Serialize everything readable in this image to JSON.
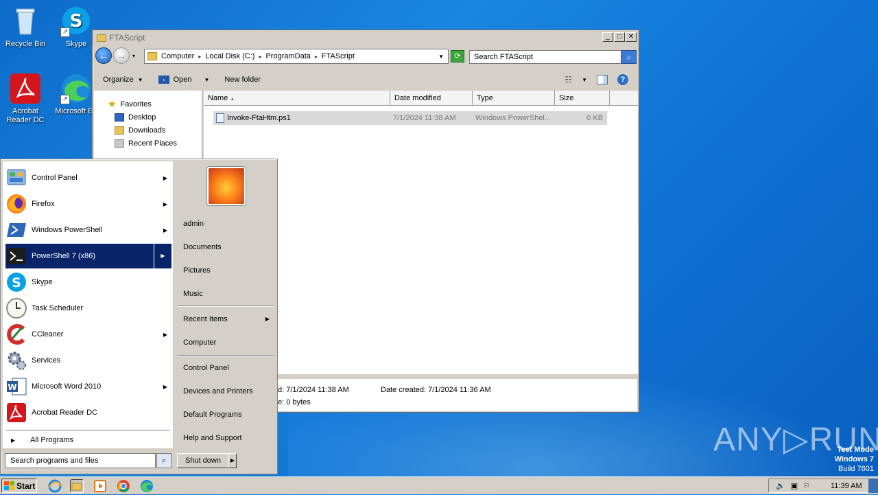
{
  "desktop": {
    "icons": [
      {
        "label": "Recycle Bin"
      },
      {
        "label": "Skype"
      },
      {
        "label": "Acrobat Reader DC"
      },
      {
        "label": "Microsoft Ed"
      }
    ]
  },
  "explorer": {
    "title": "FTAScript",
    "address": [
      "Computer",
      "Local Disk (C:)",
      "ProgramData",
      "FTAScript"
    ],
    "search_placeholder": "Search FTAScript",
    "toolbar": {
      "organize": "Organize",
      "open": "Open",
      "new_folder": "New folder"
    },
    "nav": {
      "favorites": "Favorites",
      "desktop": "Desktop",
      "downloads": "Downloads",
      "recent": "Recent Places"
    },
    "columns": [
      "Name",
      "Date modified",
      "Type",
      "Size"
    ],
    "files": [
      {
        "name": "Invoke-FtaHtm.ps1",
        "modified": "7/1/2024 11:38 AM",
        "type": "Windows PowerShel...",
        "size": "0 KB"
      }
    ],
    "details": {
      "modified": "d: 7/1/2024 11:38 AM",
      "created": "Date created: 7/1/2024 11:36 AM",
      "size": "e: 0 bytes"
    }
  },
  "start_menu": {
    "programs": [
      {
        "label": "Control Panel"
      },
      {
        "label": "Firefox"
      },
      {
        "label": "Windows PowerShell"
      },
      {
        "label": "PowerShell 7 (x86)"
      },
      {
        "label": "Skype"
      },
      {
        "label": "Task Scheduler"
      },
      {
        "label": "CCleaner"
      },
      {
        "label": "Services"
      },
      {
        "label": "Microsoft Word 2010"
      },
      {
        "label": "Acrobat Reader DC"
      }
    ],
    "all_programs": "All Programs",
    "right": {
      "user": "admin",
      "documents": "Documents",
      "pictures": "Pictures",
      "music": "Music",
      "recent_items": "Recent Items",
      "computer": "Computer",
      "control_panel": "Control Panel",
      "devices": "Devices and Printers",
      "default_programs": "Default Programs",
      "help": "Help and Support"
    },
    "search_placeholder": "Search programs and files",
    "shutdown": "Shut down"
  },
  "taskbar": {
    "start": "Start",
    "clock": "11:39 AM"
  },
  "overlay": {
    "watermark": "ANY▷RUN",
    "test_mode": "Test Mode",
    "os": "Windows 7",
    "build": "Build 7601"
  }
}
